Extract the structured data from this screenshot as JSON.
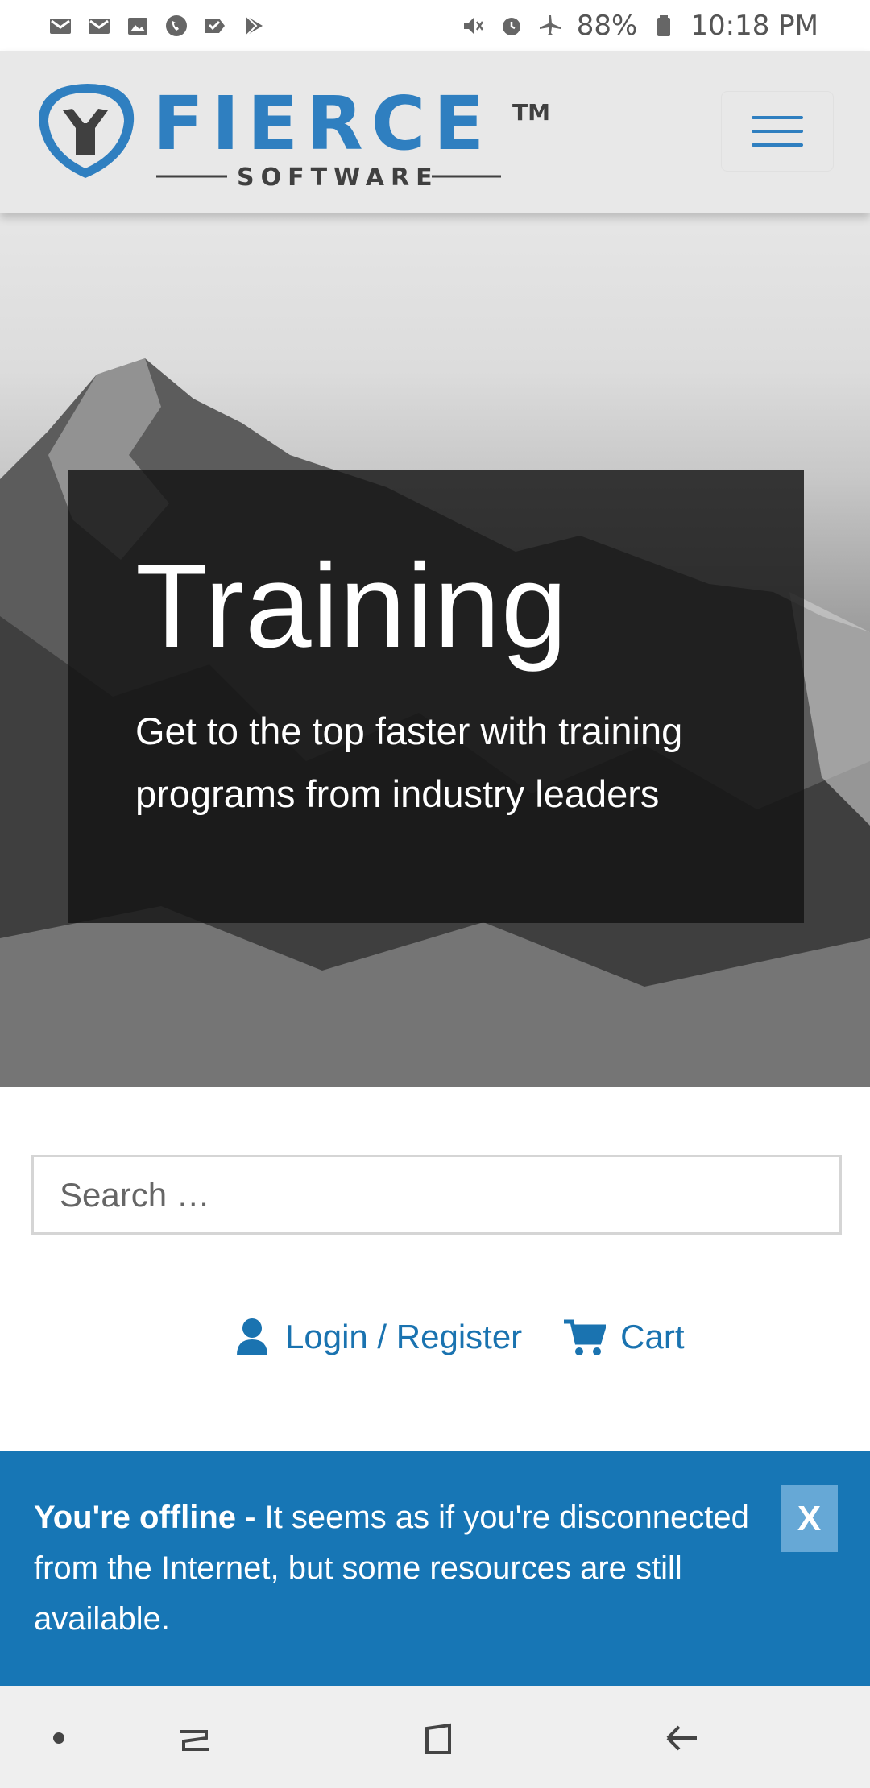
{
  "status_bar": {
    "left_icons": [
      "gmail-icon",
      "gmail-icon",
      "gallery-icon",
      "phone-icon",
      "check-icon",
      "play-store-icon"
    ],
    "right_icons": [
      "mute-icon",
      "alarm-icon",
      "airplane-icon"
    ],
    "battery": "88%",
    "time": "10:18 PM"
  },
  "header": {
    "logo_text": "FIERCE",
    "logo_sub": "SOFTWARE",
    "logo_tm": "TM",
    "brand_color": "#2f7fc0"
  },
  "hero": {
    "title": "Training",
    "subtitle": "Get to the top faster with training programs from industry leaders"
  },
  "search": {
    "placeholder": "Search …"
  },
  "links": {
    "login": "Login / Register",
    "cart": "Cart",
    "color": "#1a73b0"
  },
  "offline_banner": {
    "bold": "You're offline - ",
    "message": "It seems as if you're disconnected from the Internet, but some resources are still available.",
    "close_label": "X",
    "background": "#1776b5"
  },
  "nav_bar": {
    "items": [
      "dot-icon",
      "recent-apps-icon",
      "home-icon",
      "back-icon"
    ]
  }
}
